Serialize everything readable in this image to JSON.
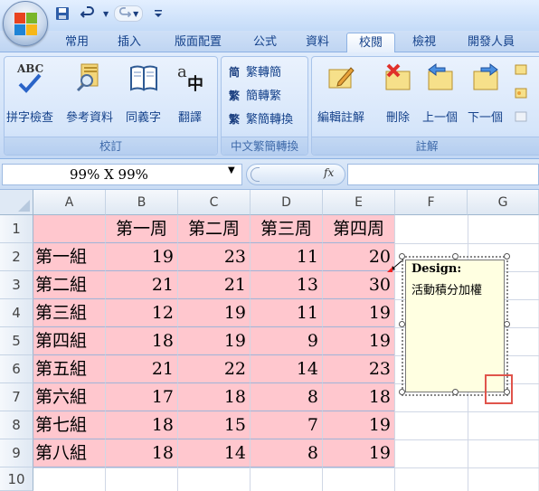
{
  "quick_access": {
    "save_icon": "save-icon",
    "undo_icon": "undo-icon",
    "redo_icon": "redo-icon",
    "customize_icon": "customize-qat-icon"
  },
  "tabs": [
    "常用",
    "插入",
    "版面配置",
    "公式",
    "資料",
    "校閱",
    "檢視",
    "開發人員"
  ],
  "active_tab": "校閱",
  "ribbon": {
    "proofing": {
      "label": "校訂",
      "spelling": "拼字檢查",
      "research": "參考資料",
      "thesaurus": "同義字",
      "translate": "翻譯",
      "abc_text": "ABC",
      "translate_glyph_a": "a",
      "translate_glyph_zh": "中"
    },
    "chinese_conversion": {
      "label": "中文繁簡轉換",
      "to_simplified": "繁轉簡",
      "to_traditional": "簡轉繁",
      "convert": "繁簡轉換",
      "to_simplified_glyph": "简",
      "to_traditional_glyph": "繁",
      "convert_glyph": "繁"
    },
    "comments": {
      "label": "註解",
      "edit": "編輯註解",
      "delete": "刪除",
      "previous": "上一個",
      "next": "下一個"
    }
  },
  "formula_bar": {
    "name_box": "99% X 99%",
    "fx": "fx",
    "value": ""
  },
  "grid": {
    "columns": [
      "A",
      "B",
      "C",
      "D",
      "E",
      "F",
      "G"
    ],
    "rows": [
      "1",
      "2",
      "3",
      "4",
      "5",
      "6",
      "7",
      "8",
      "9",
      "10"
    ],
    "header_row": [
      "",
      "第一周",
      "第二周",
      "第三周",
      "第四周"
    ],
    "data": [
      [
        "第一組",
        "19",
        "23",
        "11",
        "20"
      ],
      [
        "第二組",
        "21",
        "21",
        "13",
        "30"
      ],
      [
        "第三組",
        "12",
        "19",
        "11",
        "19"
      ],
      [
        "第四組",
        "18",
        "19",
        "9",
        "19"
      ],
      [
        "第五組",
        "21",
        "22",
        "14",
        "23"
      ],
      [
        "第六組",
        "17",
        "18",
        "8",
        "18"
      ],
      [
        "第七組",
        "18",
        "15",
        "7",
        "19"
      ],
      [
        "第八組",
        "18",
        "14",
        "8",
        "19"
      ]
    ],
    "highlight_color": "#ffc7ce"
  },
  "comment": {
    "author": "Design:",
    "text": "活動積分加權"
  },
  "colors": {
    "ribbon_text": "#15428b",
    "comment_bg": "#ffffe1",
    "highlight_box": "#e0544b"
  }
}
